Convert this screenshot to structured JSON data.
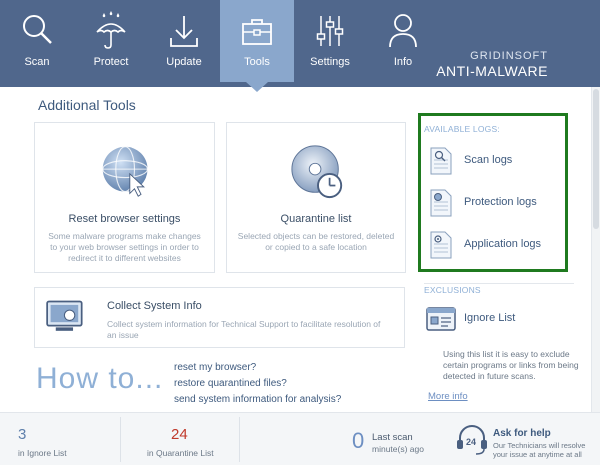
{
  "nav": {
    "items": [
      {
        "label": "Scan",
        "icon": "search-icon"
      },
      {
        "label": "Protect",
        "icon": "umbrella-icon"
      },
      {
        "label": "Update",
        "icon": "download-icon"
      },
      {
        "label": "Tools",
        "icon": "toolbox-icon",
        "active": true
      },
      {
        "label": "Settings",
        "icon": "sliders-icon"
      },
      {
        "label": "Info",
        "icon": "user-icon"
      }
    ]
  },
  "brand": {
    "line1": "GRIDINSOFT",
    "line2": "ANTI-MALWARE"
  },
  "main": {
    "title": "Additional Tools",
    "cards": {
      "browser": {
        "title": "Reset browser settings",
        "desc": "Some malware programs make changes to your web browser settings in order to redirect it to different websites"
      },
      "quarantine": {
        "title": "Quarantine list",
        "desc": "Selected objects can be restored, deleted or copied to a safe location"
      },
      "collect": {
        "title": "Collect System Info",
        "desc": "Collect system information for Technical Support to facilitate resolution of an issue"
      }
    },
    "howto": {
      "title": "How to...",
      "links": [
        "reset my browser?",
        "restore quarantined files?",
        "send system information for analysis?"
      ]
    }
  },
  "panel": {
    "logs_heading": "AVAILABLE LOGS:",
    "logs": [
      "Scan logs",
      "Protection logs",
      "Application logs"
    ],
    "exclusions_heading": "EXCLUSIONS",
    "ignore_label": "Ignore List",
    "exclusions_desc": "Using this list it is easy to exclude certain programs or links from being detected in future scans.",
    "more_info": "More info"
  },
  "footer": {
    "ignore_count": "3",
    "ignore_label": "in Ignore List",
    "quarantine_count": "24",
    "quarantine_label": "in Quarantine List",
    "last_scan_value": "0",
    "last_scan_title": "Last scan",
    "last_scan_sub": "minute(s) ago",
    "help_badge": "24",
    "help_title": "Ask for help",
    "help_desc": "Our Technicians will resolve your issue at anytime at all"
  },
  "colors": {
    "nav_bg": "#50678c",
    "nav_active": "#8aa7cc",
    "highlight_box": "#1f7a1f",
    "quarantine_count": "#c0392b",
    "accent_text": "#3e5a7e"
  }
}
